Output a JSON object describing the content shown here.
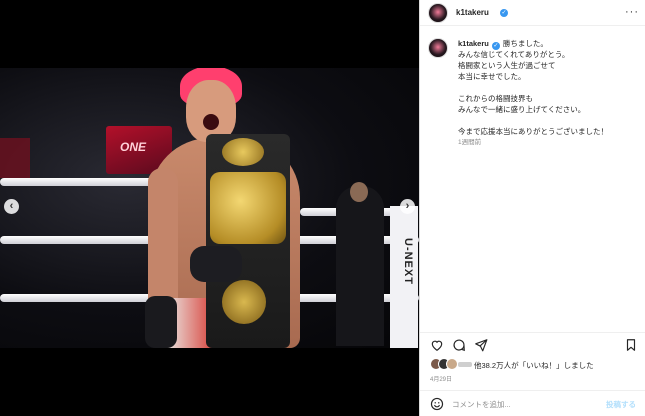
{
  "post": {
    "username": "k1takeru",
    "verified": true
  },
  "caption": {
    "username": "k1takeru",
    "lines": [
      "勝ちました。",
      "みんな信じてくれてありがとう。",
      "格闘家という人生が過ごせて",
      "本当に幸せでした。",
      "",
      "これからの格闘技界も",
      "みんなで一緒に盛り上げてください。",
      "",
      "今まで応援本当にありがとうございました！"
    ],
    "meta": "1週間前"
  },
  "photo": {
    "screen_text": "ONE",
    "post_text": "U-NEXT"
  },
  "likes": {
    "text": "他38.2万人が「いいね！」しました"
  },
  "date": "4月29日",
  "comment": {
    "placeholder": "コメントを追加...",
    "post_label": "投稿する"
  },
  "colors": {
    "accent": "#3897f0",
    "post_button": "#b2dffc",
    "hair": "#ff3f6e"
  },
  "icons": [
    "chevron-left-icon",
    "chevron-right-icon",
    "heart-icon",
    "comment-icon",
    "share-icon",
    "bookmark-icon",
    "emoji-icon",
    "more-icon",
    "verified-icon"
  ]
}
